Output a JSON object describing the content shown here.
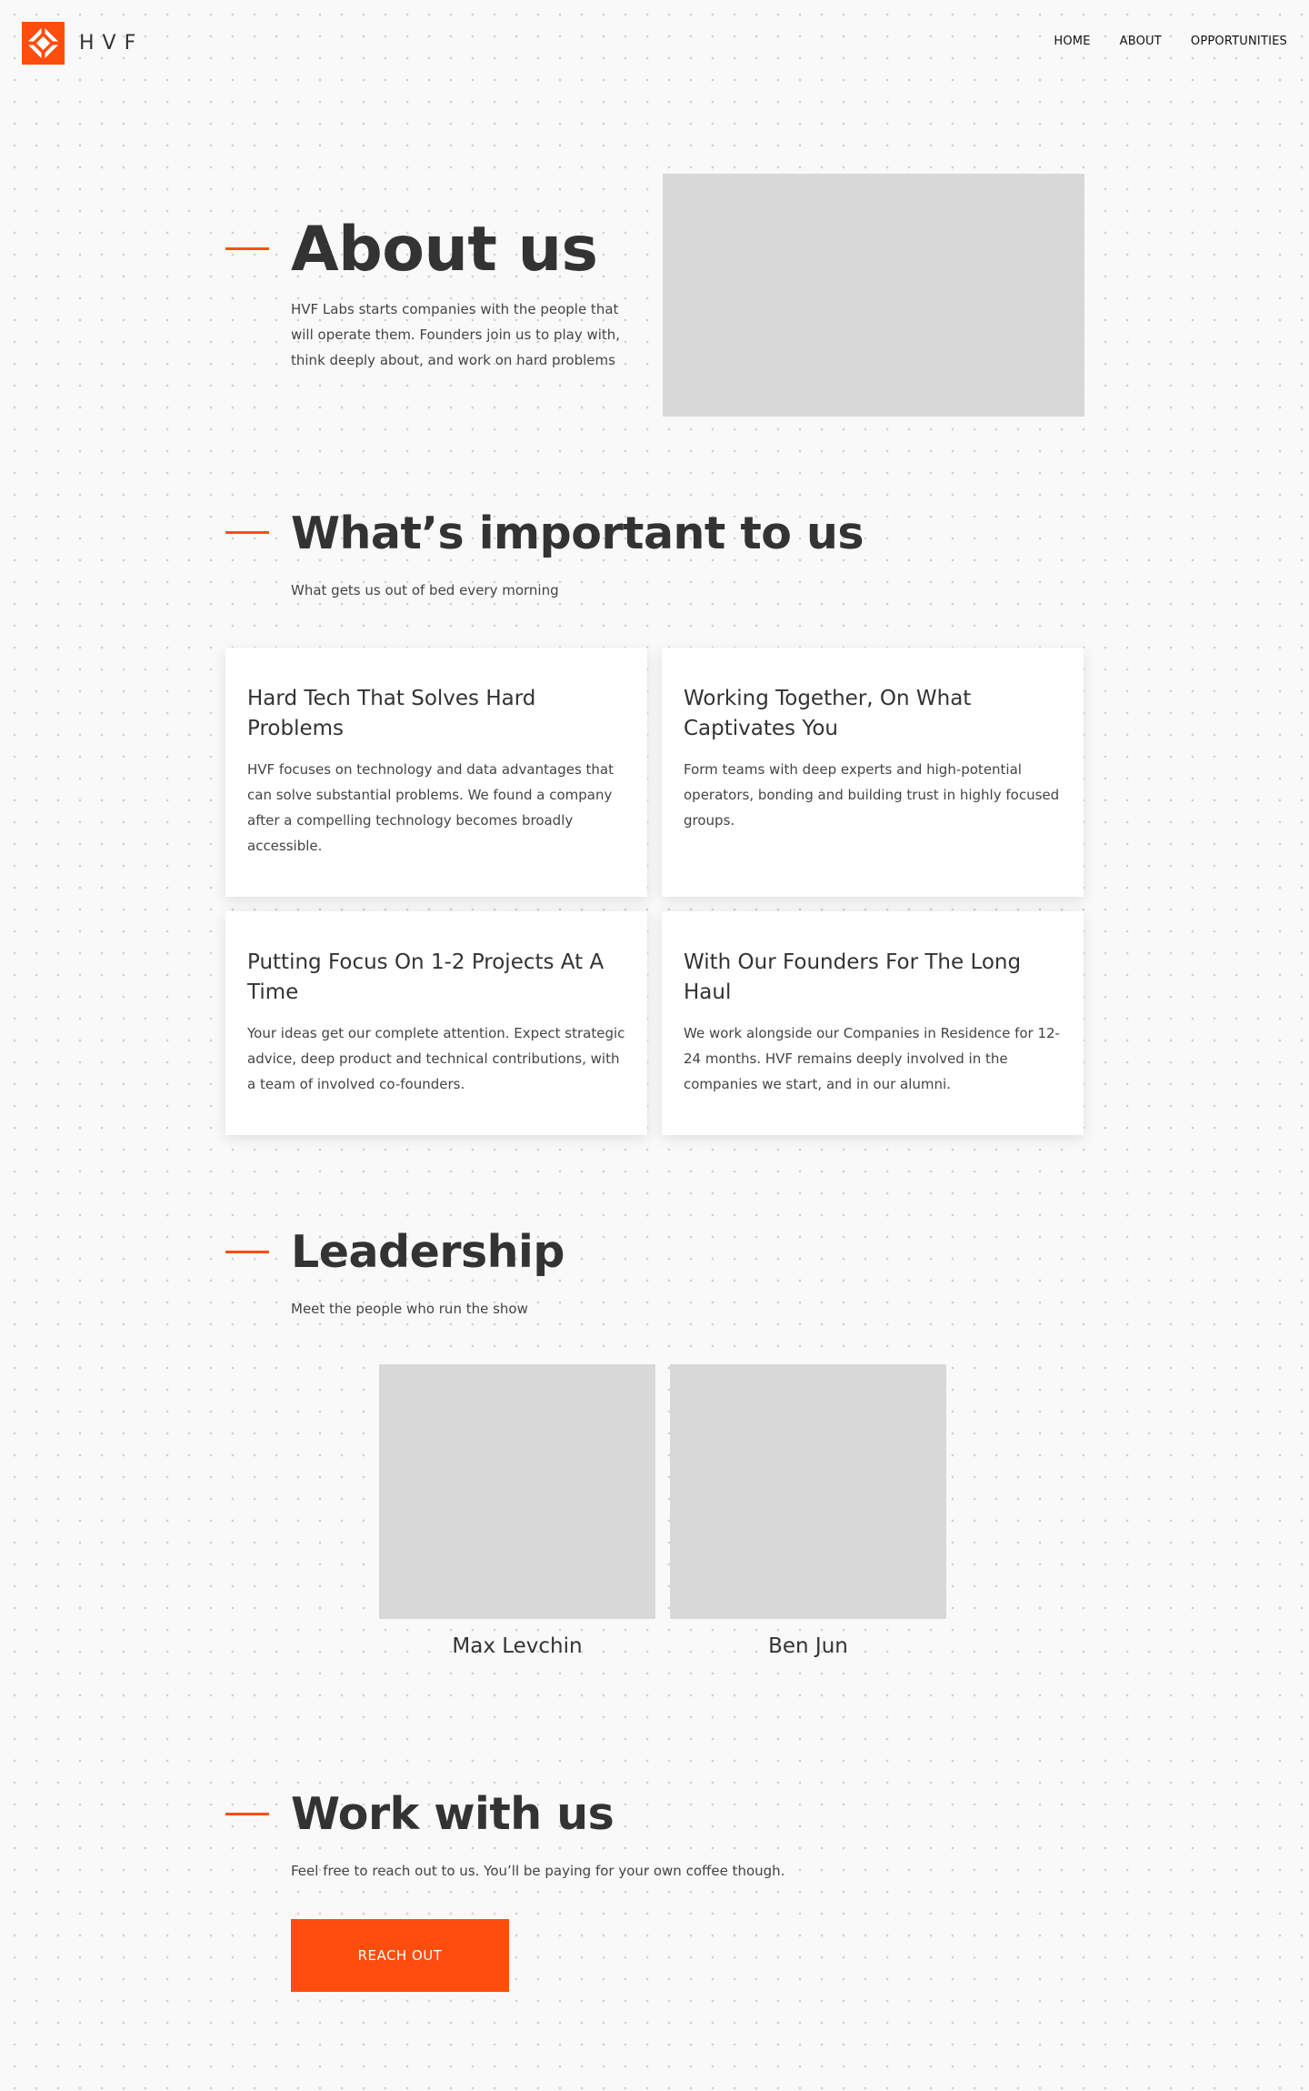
{
  "brand": {
    "name": "HVF",
    "accent": "#ff4d0d"
  },
  "nav": {
    "items": [
      {
        "label": "HOME"
      },
      {
        "label": "ABOUT"
      },
      {
        "label": "OPPORTUNITIES"
      }
    ]
  },
  "about": {
    "title": "About us",
    "description": "HVF Labs starts companies with the people that will operate them. Founders join us to play with, think deeply about, and work on hard problems"
  },
  "important": {
    "title": "What’s important to us",
    "subtitle": "What gets us out of bed every morning",
    "cards": [
      {
        "title": "Hard Tech That Solves Hard Problems",
        "body": "HVF focuses on technology and data advantages that can solve substantial problems. We found a company after a compelling technology becomes broadly accessible."
      },
      {
        "title": "Working Together, On What Captivates You",
        "body": "Form teams with deep experts and high-potential operators, bonding and building trust in highly focused groups."
      },
      {
        "title": "Putting Focus On 1-2 Projects At A Time",
        "body": "Your ideas get our complete attention. Expect strategic advice, deep product and technical contributions, with a team of involved co-founders."
      },
      {
        "title": "With Our Founders For The Long Haul",
        "body": "We work alongside our Companies in Residence for 12-24 months. HVF remains deeply involved in the companies we start, and in our alumni."
      }
    ]
  },
  "leadership": {
    "title": "Leadership",
    "subtitle": "Meet the people who run the show",
    "people": [
      {
        "name": "Max Levchin"
      },
      {
        "name": "Ben Jun"
      }
    ]
  },
  "work": {
    "title": "Work with us",
    "subtitle": "Feel free to reach out to us. You’ll be paying for your own coffee though.",
    "button_label": "REACH OUT"
  }
}
